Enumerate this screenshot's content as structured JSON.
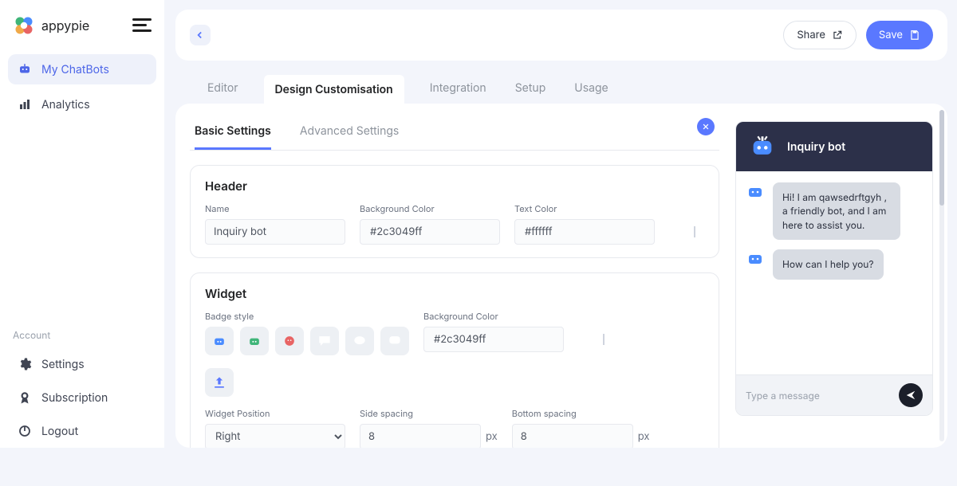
{
  "brand": {
    "name": "appypie"
  },
  "sidebar": {
    "items": [
      {
        "label": "My ChatBots",
        "icon": "bot-icon"
      },
      {
        "label": "Analytics",
        "icon": "chart-icon"
      }
    ],
    "account_label": "Account",
    "account_items": [
      {
        "label": "Settings",
        "icon": "gear-icon"
      },
      {
        "label": "Subscription",
        "icon": "badge-icon"
      },
      {
        "label": "Logout",
        "icon": "power-icon"
      }
    ]
  },
  "topbar": {
    "share_label": "Share",
    "save_label": "Save"
  },
  "tabs": {
    "items": [
      "Editor",
      "Design Customisation",
      "Integration",
      "Setup",
      "Usage"
    ],
    "active": "Design Customisation"
  },
  "subtabs": {
    "items": [
      "Basic Settings",
      "Advanced Settings"
    ],
    "active": "Basic Settings"
  },
  "header_section": {
    "title": "Header",
    "labels": {
      "name": "Name",
      "bg": "Background Color",
      "text": "Text Color"
    },
    "name_value": "Inquiry bot",
    "bg_value": "#2c3049ff",
    "bg_swatch": "#14161c",
    "text_value": "#ffffff",
    "text_swatch": "#ffffff"
  },
  "widget_section": {
    "title": "Widget",
    "labels": {
      "badge": "Badge style",
      "bg": "Background Color",
      "position": "Widget Position",
      "side": "Side spacing",
      "bottom": "Bottom spacing"
    },
    "bg_value": "#2c3049ff",
    "bg_swatch": "#14161c",
    "position_value": "Right",
    "side_value": "8",
    "bottom_value": "8",
    "px_suffix": "px"
  },
  "preview": {
    "title": "Inquiry bot",
    "header_bg": "#2c3049",
    "messages": [
      "Hi! I am qawsedrftgyh , a friendly bot, and I am here to assist you.",
      "How can I help you?"
    ],
    "input_placeholder": "Type a message"
  }
}
